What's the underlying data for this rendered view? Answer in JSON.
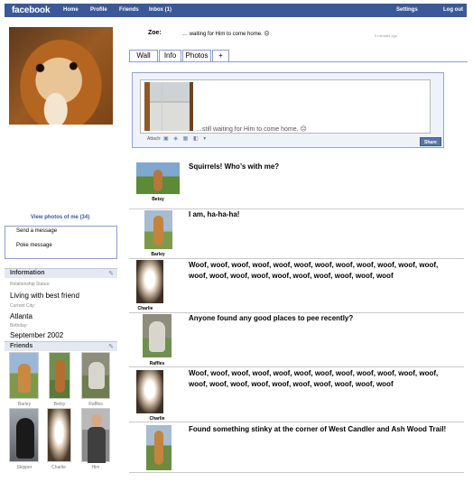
{
  "topbar": {
    "logo": "facebook",
    "nav": [
      "Home",
      "Profile",
      "Friends",
      "Inbox (1)"
    ],
    "settings": "Settings",
    "logout": "Log out"
  },
  "profile": {
    "view_photos": "View photos of me (34)",
    "actions": [
      "Send a message",
      "Poke message"
    ]
  },
  "information": {
    "header": "Information",
    "relationship_label": "Relationship Status:",
    "relationship_value": "Living with best friend",
    "city_label": "Current City:",
    "city_value": "Atlanta",
    "birthday_label": "Birthday:",
    "birthday_value": "September 2002"
  },
  "friends": {
    "header": "Friends",
    "items": [
      {
        "name": "Barley"
      },
      {
        "name": "Betsy"
      },
      {
        "name": "Raffles"
      },
      {
        "name": "Skipper"
      },
      {
        "name": "Charlie"
      },
      {
        "name": "Him"
      }
    ]
  },
  "status": {
    "name": "Zoe:",
    "text": "… waiting for Him to come home. ☹",
    "time": "5 minutes ago"
  },
  "tabs": [
    "Wall",
    "Info",
    "Photos",
    "+"
  ],
  "composer": {
    "text": "…still waiting for Him to come home. ☹",
    "attach_label": "Attach:",
    "attach_icons": "▣ ◈ ▦ ◧ ▾",
    "share_label": "Share"
  },
  "posts": [
    {
      "author": "Betsy",
      "text": "Squirrels!  Who’s with me?"
    },
    {
      "author": "Barley",
      "text": "I am, ha-ha-ha!"
    },
    {
      "author": "Charlie",
      "text": "Woof, woof, woof, woof, woof, woof, woof, woof, woof, woof, woof, woof, woof, woof, woof, woof, woof, woof, woof, woof, woof, woof"
    },
    {
      "author": "Raffles",
      "text": "Anyone found any good places to pee recently?"
    },
    {
      "author": "Charlie",
      "text": "Woof, woof, woof, woof, woof, woof, woof, woof, woof, woof, woof, woof, woof, woof, woof, woof, woof, woof, woof, woof, woof, woof"
    },
    {
      "author": "",
      "text": "Found something stinky at the corner of West Candler and Ash Wood Trail!"
    }
  ],
  "colors": {
    "brand": "#3b5998",
    "link": "#3b5998",
    "button": "#5b74a8"
  }
}
